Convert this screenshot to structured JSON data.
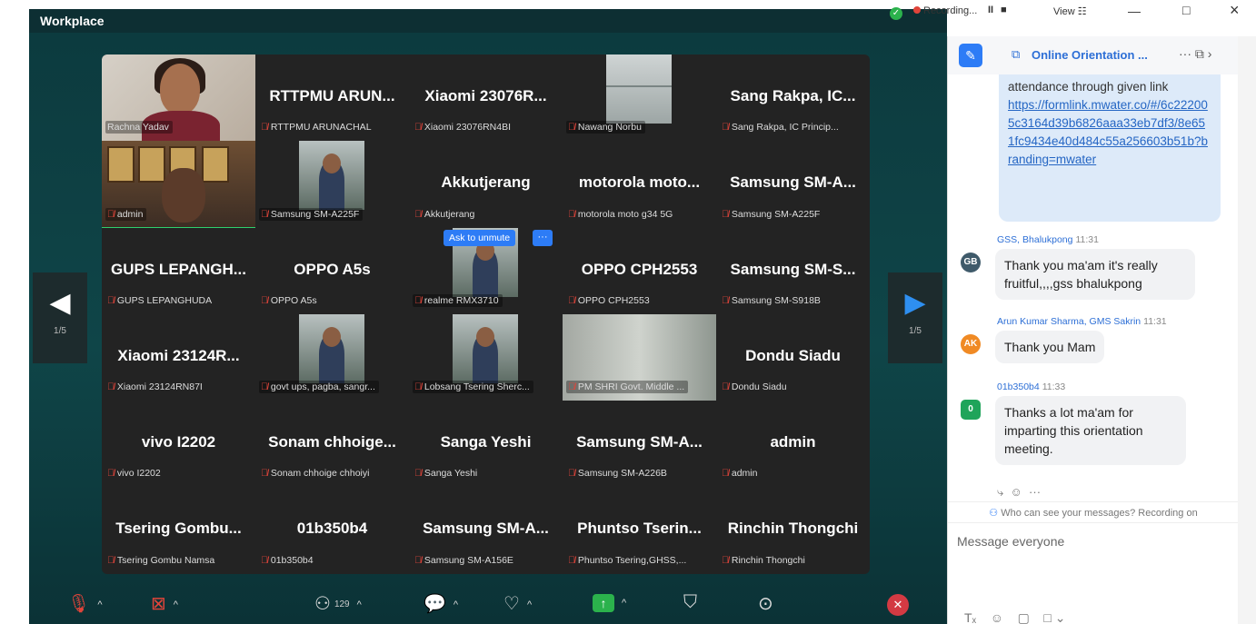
{
  "app": {
    "title": "Workplace"
  },
  "window": {
    "recording": "Recording...",
    "view": "View",
    "pause": "II",
    "stop": "■",
    "view_icon": "☷",
    "minimize": "—",
    "maximize": "□",
    "close": "×"
  },
  "grid": {
    "tiles": [
      {
        "big": "",
        "sub": "Rachna Yadav",
        "muted": false,
        "video": "a"
      },
      {
        "big": "RTTPMU ARUN...",
        "sub": "RTTPMU ARUNACHAL",
        "muted": true
      },
      {
        "big": "Xiaomi 23076R...",
        "sub": "Xiaomi 23076RN4BI",
        "muted": true
      },
      {
        "big": "",
        "sub": "Nawang Norbu",
        "muted": true,
        "video": "blank"
      },
      {
        "big": "Sang Rakpa, IC...",
        "sub": "Sang Rakpa, IC Princip...",
        "muted": true
      },
      {
        "big": "",
        "sub": "admin",
        "muted": true,
        "video": "b",
        "active": true
      },
      {
        "big": "",
        "sub": "Samsung SM-A225F",
        "muted": true,
        "video": "small"
      },
      {
        "big": "Akkutjerang",
        "sub": "Akkutjerang",
        "muted": true
      },
      {
        "big": "motorola moto...",
        "sub": "motorola moto g34 5G",
        "muted": true
      },
      {
        "big": "Samsung SM-A...",
        "sub": "Samsung SM-A225F",
        "muted": true
      },
      {
        "big": "GUPS LEPANGH...",
        "sub": "GUPS LEPANGHUDA",
        "muted": true
      },
      {
        "big": "OPPO A5s",
        "sub": "OPPO A5s",
        "muted": true
      },
      {
        "big": "",
        "sub": "realme RMX3710",
        "muted": true,
        "video": "small",
        "unmute": true
      },
      {
        "big": "OPPO CPH2553",
        "sub": "OPPO CPH2553",
        "muted": true
      },
      {
        "big": "Samsung SM-S...",
        "sub": "Samsung SM-S918B",
        "muted": true
      },
      {
        "big": "Xiaomi 23124R...",
        "sub": "Xiaomi 23124RN87I",
        "muted": true
      },
      {
        "big": "",
        "sub": "govt ups, pagba, sangr...",
        "muted": true,
        "video": "small"
      },
      {
        "big": "",
        "sub": "Lobsang Tsering Sherc...",
        "muted": true,
        "video": "small"
      },
      {
        "big": "",
        "sub": "PM SHRI Govt. Middle ...",
        "muted": true,
        "video": "wide"
      },
      {
        "big": "Dondu Siadu",
        "sub": "Dondu Siadu",
        "muted": true
      },
      {
        "big": "vivo I2202",
        "sub": "vivo I2202",
        "muted": true
      },
      {
        "big": "Sonam chhoige...",
        "sub": "Sonam chhoige chhoiyi",
        "muted": true
      },
      {
        "big": "Sanga Yeshi",
        "sub": "Sanga Yeshi",
        "muted": true
      },
      {
        "big": "Samsung SM-A...",
        "sub": "Samsung SM-A226B",
        "muted": true
      },
      {
        "big": "admin",
        "sub": "admin",
        "muted": true
      },
      {
        "big": "Tsering Gombu...",
        "sub": "Tsering Gombu Namsa",
        "muted": true
      },
      {
        "big": "01b350b4",
        "sub": "01b350b4",
        "muted": true
      },
      {
        "big": "Samsung SM-A...",
        "sub": "Samsung SM-A156E",
        "muted": true
      },
      {
        "big": "Phuntso Tserin...",
        "sub": "Phuntso Tsering,GHSS,...",
        "muted": true
      },
      {
        "big": "Rinchin Thongchi",
        "sub": "Rinchin Thongchi",
        "muted": true
      }
    ],
    "unmute_label": "Ask to unmute",
    "more_label": "···"
  },
  "nav": {
    "left_page": "1/5",
    "right_page": "1/5",
    "left_arrow": "◀",
    "right_arrow": "▶"
  },
  "toolbar": {
    "participants_count": "129",
    "caret": "^"
  },
  "chat": {
    "title": "Online Orientation ...",
    "header_icons": "···  ⧉  ›",
    "link_text_pre": "attendance through given link",
    "link_url": "https://formlink.mwater.co/#/6c222005c3164d39b6826aaa33eb7df3/8e651fc9434e40d484c55a256603b51b?branding=mwater",
    "messages": [
      {
        "initials": "GB",
        "sender": "GSS, Bhalukpong",
        "time": "11:31",
        "text": "Thank you ma'am it's really fruitful,,,,gss bhalukpong"
      },
      {
        "initials": "AK",
        "sender": "Arun Kumar Sharma, GMS Sakrin",
        "time": "11:31",
        "text": "Thank you Mam"
      },
      {
        "initials": "0",
        "sender": "01b350b4",
        "time": "11:33",
        "text": "Thanks a lot ma'am for imparting this orientation meeting."
      }
    ],
    "who_can_see": "Who can see your messages? Recording on",
    "input_placeholder": "Message everyone"
  }
}
